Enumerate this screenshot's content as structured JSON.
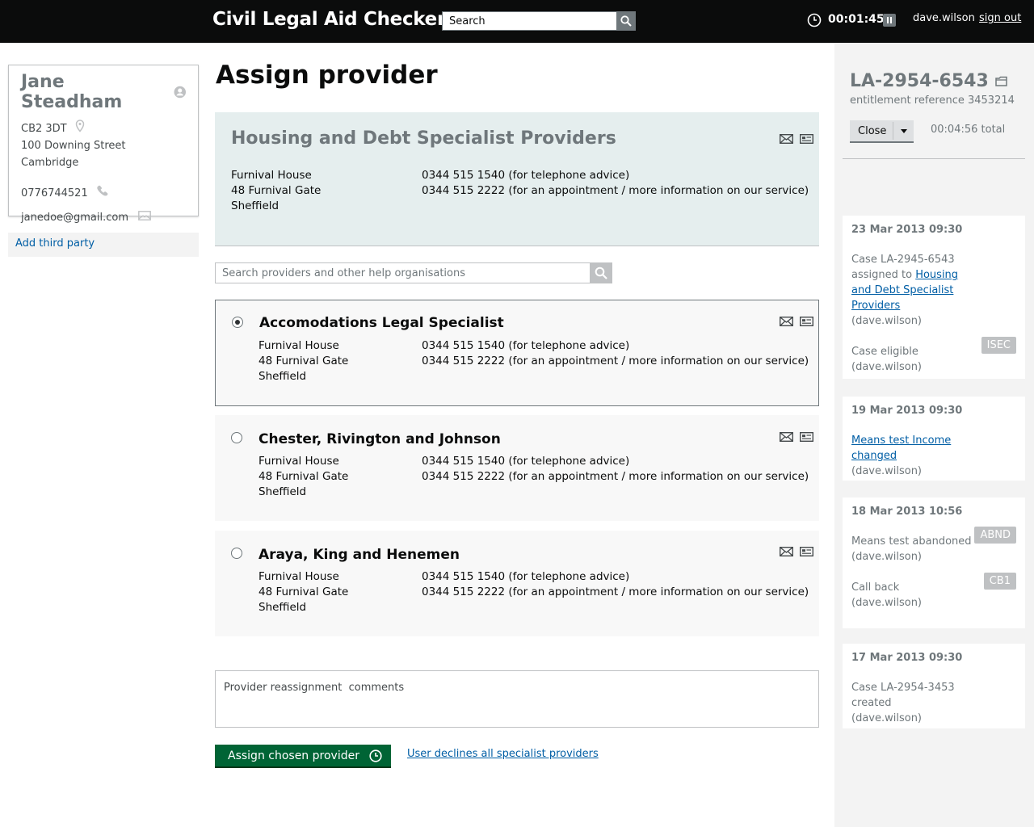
{
  "header": {
    "app_title": "Civil Legal Aid Checker",
    "search_placeholder": "Search",
    "timer": "00:01:45",
    "username": "dave.wilson",
    "signout": "sign out"
  },
  "client": {
    "name": "Jane Steadham",
    "postcode": "CB2 3DT",
    "street": "100 Downing Street",
    "city": "Cambridge",
    "phone": "0776744521",
    "email": "janedoe@gmail.com",
    "add_third_party": "Add third party"
  },
  "main": {
    "page_title": "Assign provider",
    "assigned": {
      "name": "Housing and Debt Specialist Providers",
      "address": [
        "Furnival House",
        "48 Furnival Gate",
        "Sheffield"
      ],
      "phones": [
        "0344 515 1540 (for telephone advice)",
        "0344 515 2222 (for an appointment / more information on our service)"
      ]
    },
    "provider_search_placeholder": "Search providers and other help organisations",
    "providers": [
      {
        "name": "Accomodations Legal Specialist",
        "selected": true,
        "address": [
          "Furnival House",
          "48 Furnival Gate",
          "Sheffield"
        ],
        "phones": [
          "0344 515 1540 (for telephone advice)",
          "0344 515 2222 (for an appointment / more information on our service)"
        ]
      },
      {
        "name": "Chester, Rivington and Johnson",
        "selected": false,
        "address": [
          "Furnival House",
          "48 Furnival Gate",
          "Sheffield"
        ],
        "phones": [
          "0344 515 1540 (for telephone advice)",
          "0344 515 2222 (for an appointment / more information on our service)"
        ]
      },
      {
        "name": "Araya, King and Henemen",
        "selected": false,
        "address": [
          "Furnival House",
          "48 Furnival Gate",
          "Sheffield"
        ],
        "phones": [
          "0344 515 1540 (for telephone advice)",
          "0344 515 2222 (for an appointment / more information on our service)"
        ]
      }
    ],
    "comments_placeholder": "Provider reassignment  comments",
    "assign_button": "Assign  chosen provider",
    "decline_link": "User declines all specialist providers"
  },
  "sidebar": {
    "case_ref": "LA-2954-6543",
    "entitlement": "entitlement reference 3453214",
    "close_label": "Close",
    "total_time": "00:04:56 total",
    "log": [
      {
        "date": "23 Mar 2013 09:30",
        "entries": [
          {
            "text": "Case LA-2945-6543 assigned to",
            "link": "Housing and Debt Specialist Providers",
            "user": "(dave.wilson)",
            "badge": ""
          },
          {
            "text": "Case eligible",
            "link": "",
            "user": "(dave.wilson)",
            "badge": "ISEC"
          }
        ]
      },
      {
        "date": "19 Mar 2013 09:30",
        "entries": [
          {
            "text": "",
            "link": "Means test Income changed",
            "user": "(dave.wilson)",
            "badge": ""
          }
        ]
      },
      {
        "date": "18 Mar 2013 10:56",
        "entries": [
          {
            "text": "Means test abandoned",
            "link": "",
            "user": "(dave.wilson)",
            "badge": "ABND"
          },
          {
            "text": "Call back",
            "link": "",
            "user": "(dave.wilson)",
            "badge": "CB1"
          }
        ]
      },
      {
        "date": "17 Mar 2013 09:30",
        "entries": [
          {
            "text": "Case LA-2954-3453 created",
            "link": "",
            "user": "(dave.wilson)",
            "badge": ""
          }
        ]
      }
    ]
  },
  "colors": {
    "header_bg": "#0b0c0c",
    "link": "#005ea5",
    "button_green": "#006435",
    "assigned_bg": "#e5eeee",
    "sidebar_bg": "#f3f3f3"
  }
}
